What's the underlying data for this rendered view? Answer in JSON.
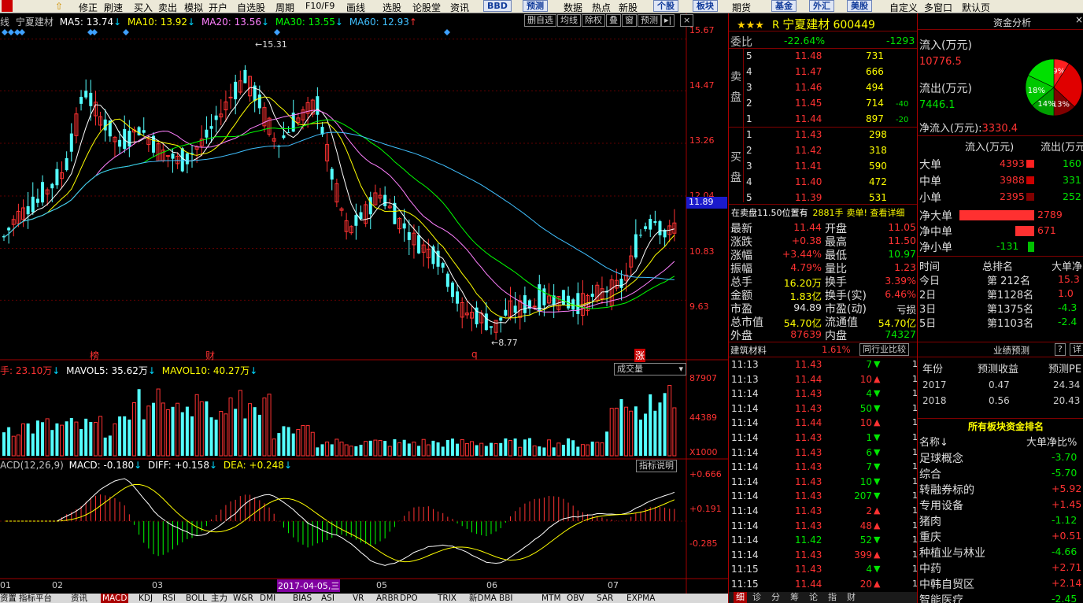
{
  "toolbar": {
    "items": [
      "修正",
      "刷速",
      "买入",
      "卖出",
      "模拟",
      "开户",
      "自选股",
      "周期",
      "F10/F9",
      "画线",
      "选股",
      "论股堂",
      "资讯"
    ],
    "bbd": "BBD",
    "yuce": "预测",
    "items2": [
      "数据",
      "热点",
      "新股"
    ],
    "gegu": "个股",
    "bankuai": "板块",
    "items3": [
      "期货",
      "基金",
      "外汇",
      "美股",
      "自定义",
      "多窗口",
      "默认页"
    ]
  },
  "chart": {
    "ma_line": {
      "prefix": "线",
      "name": "宁夏建材",
      "ma5": "MA5: 13.74",
      "ma10": "MA10: 13.92",
      "ma20": "MA20: 13.56",
      "ma30": "MA30: 13.55",
      "ma60": "MA60: 12.93"
    },
    "top_buttons": [
      "删自选",
      "均线",
      "除权",
      "叠",
      "窗",
      "预测"
    ],
    "price_axis": [
      "15.67",
      "14.47",
      "13.26",
      "12.04",
      "10.83",
      "9.63"
    ],
    "current_price_tag": "11.89",
    "high_label": "15.31",
    "low_label": "8.77",
    "markers": [
      "榜",
      "财",
      "q",
      "涨"
    ],
    "volume": {
      "label": "手: 23.10万",
      "mavol5": "MAVOL5: 35.62万",
      "mavol10": "MAVOL10: 40.27万",
      "button": "成交量",
      "axis": [
        "87907",
        "44389"
      ],
      "unit": "X1000"
    },
    "macd": {
      "label": "ACD(12,26,9)",
      "macd": "MACD: -0.180",
      "diff": "DIFF: +0.158",
      "dea": "DEA: +0.248",
      "button": "指标说明",
      "axis": [
        "+0.666",
        "+0.191",
        "-0.285"
      ]
    },
    "date_axis": [
      "01",
      "02",
      "03",
      "2017-04-05,三",
      "05",
      "06",
      "07"
    ],
    "bottom_tabs": [
      "资置",
      "指标平台",
      "资讯",
      "MACD",
      "KDJ",
      "RSI",
      "BOLL",
      "主力",
      "W&R",
      "DMI",
      "BIAS",
      "ASI",
      "VR",
      "ARBR",
      "DPO",
      "TRIX",
      "新DMA",
      "BBI",
      "MTM",
      "OBV",
      "SAR",
      "EXPMA"
    ]
  },
  "chart_data": {
    "type": "candlestick",
    "title": "宁夏建材",
    "ylim": [
      8.4,
      15.9
    ],
    "x": [
      "01",
      "02",
      "03",
      "04",
      "05",
      "06",
      "07"
    ],
    "high": 15.31,
    "low": 8.77,
    "last": 11.44
  },
  "quote": {
    "stars": "★★★",
    "flag": "R",
    "name": "宁夏建材",
    "code": "600449",
    "weibi_label": "委比",
    "weibi_value": "-22.64%",
    "weicha": "-1293",
    "sell_label": "卖\n盘",
    "buy_label": "买\n盘",
    "sells": [
      {
        "lvl": "5",
        "price": "11.48",
        "vol": "731",
        "chg": ""
      },
      {
        "lvl": "4",
        "price": "11.47",
        "vol": "666",
        "chg": ""
      },
      {
        "lvl": "3",
        "price": "11.46",
        "vol": "494",
        "chg": ""
      },
      {
        "lvl": "2",
        "price": "11.45",
        "vol": "714",
        "chg": "-40"
      },
      {
        "lvl": "1",
        "price": "11.44",
        "vol": "897",
        "chg": "-20"
      }
    ],
    "buys": [
      {
        "lvl": "1",
        "price": "11.43",
        "vol": "298"
      },
      {
        "lvl": "2",
        "price": "11.42",
        "vol": "318"
      },
      {
        "lvl": "3",
        "price": "11.41",
        "vol": "590"
      },
      {
        "lvl": "4",
        "price": "11.40",
        "vol": "472"
      },
      {
        "lvl": "5",
        "price": "11.39",
        "vol": "531"
      }
    ],
    "notice_pre": "在卖盘11.50位置有",
    "notice_vol": "2881手",
    "notice_post": "卖单! 查看详细",
    "stats": [
      [
        "最新",
        "11.44",
        "开盘",
        "11.05"
      ],
      [
        "涨跌",
        "+0.38",
        "最高",
        "11.50"
      ],
      [
        "涨幅",
        "+3.44%",
        "最低",
        "10.97"
      ],
      [
        "振幅",
        "4.79%",
        "量比",
        "1.23"
      ],
      [
        "总手",
        "16.20万",
        "换手",
        "3.39%"
      ],
      [
        "金额",
        "1.83亿",
        "换手(实)",
        "6.46%"
      ],
      [
        "市盈",
        "94.89",
        "市盈(动)",
        "亏损"
      ],
      [
        "总市值",
        "54.70亿",
        "流通值",
        "54.70亿"
      ],
      [
        "外盘",
        "87639",
        "内盘",
        "74327"
      ]
    ],
    "sector": "建筑材料",
    "sector_pct": "1.61%",
    "sector_btn": "同行业比较",
    "ticks": [
      {
        "t": "11:13",
        "p": "11.43",
        "v": "7",
        "d": "down",
        "c": "green"
      },
      {
        "t": "11:13",
        "p": "11.44",
        "v": "10",
        "d": "up",
        "c": "red"
      },
      {
        "t": "11:14",
        "p": "11.43",
        "v": "4",
        "d": "down",
        "c": "green"
      },
      {
        "t": "11:14",
        "p": "11.43",
        "v": "50",
        "d": "down",
        "c": "green"
      },
      {
        "t": "11:14",
        "p": "11.44",
        "v": "10",
        "d": "up",
        "c": "red"
      },
      {
        "t": "11:14",
        "p": "11.43",
        "v": "1",
        "d": "down",
        "c": "green"
      },
      {
        "t": "11:14",
        "p": "11.43",
        "v": "6",
        "d": "down",
        "c": "green"
      },
      {
        "t": "11:14",
        "p": "11.43",
        "v": "7",
        "d": "down",
        "c": "green"
      },
      {
        "t": "11:14",
        "p": "11.43",
        "v": "10",
        "d": "down",
        "c": "green"
      },
      {
        "t": "11:14",
        "p": "11.43",
        "v": "207",
        "d": "down",
        "c": "green"
      },
      {
        "t": "11:14",
        "p": "11.43",
        "v": "2",
        "d": "up",
        "c": "red"
      },
      {
        "t": "11:14",
        "p": "11.43",
        "v": "48",
        "d": "up",
        "c": "red"
      },
      {
        "t": "11:14",
        "p": "11.42",
        "v": "52",
        "d": "down",
        "c": "green"
      },
      {
        "t": "11:14",
        "p": "11.43",
        "v": "399",
        "d": "up",
        "c": "red"
      },
      {
        "t": "11:15",
        "p": "11.43",
        "v": "4",
        "d": "down",
        "c": "green"
      },
      {
        "t": "11:15",
        "p": "11.44",
        "v": "20",
        "d": "up",
        "c": "red"
      }
    ],
    "tick_tabs": [
      "细",
      "诊",
      "分",
      "筹",
      "论",
      "指",
      "财"
    ]
  },
  "funds": {
    "title": "资金分析",
    "inflow_label": "流入(万元)",
    "inflow": "10776.5",
    "outflow_label": "流出(万元)",
    "outflow": "7446.1",
    "net_label": "净流入(万元):",
    "net": "3330.4",
    "pie": [
      {
        "label": "9%",
        "value": 9,
        "color": "#ff2020"
      },
      {
        "label": "",
        "value": 28,
        "color": "#e00000"
      },
      {
        "label": "13%",
        "value": 13,
        "color": "#800000"
      },
      {
        "label": "14%",
        "value": 14,
        "color": "#00a000"
      },
      {
        "label": "18%",
        "value": 18,
        "color": "#00c800"
      },
      {
        "label": "",
        "value": 18,
        "color": "#00e000"
      }
    ],
    "table_head": [
      "流入(万元)",
      "流出(万元)"
    ],
    "table": [
      {
        "name": "大单",
        "in": "4393",
        "out": "160"
      },
      {
        "name": "中单",
        "in": "3988",
        "out": "331"
      },
      {
        "name": "小单",
        "in": "2395",
        "out": "252"
      }
    ],
    "net_rows": [
      {
        "name": "净大单",
        "value": "2789",
        "pct": 0.35
      },
      {
        "name": "净中单",
        "value": "671",
        "pct": 0.09
      },
      {
        "name": "净小单",
        "value": "-131",
        "pct": 0.03
      }
    ],
    "rank_head": [
      "时间",
      "总排名",
      "大单净"
    ],
    "ranks": [
      {
        "t": "今日",
        "r": "第 212名",
        "v": "15.3"
      },
      {
        "t": "2日",
        "r": "第1128名",
        "v": "1.0"
      },
      {
        "t": "3日",
        "r": "第1375名",
        "v": "-4.3"
      },
      {
        "t": "5日",
        "r": "第1103名",
        "v": "-2.4"
      }
    ],
    "forecast_title": "业绩预测",
    "forecast_q": "?",
    "forecast_x": "详",
    "forecast_head": [
      "年份",
      "预测收益",
      "预测PE"
    ],
    "forecast": [
      {
        "y": "2017",
        "e": "0.47",
        "pe": "24.34"
      },
      {
        "y": "2018",
        "e": "0.56",
        "pe": "20.43"
      }
    ],
    "sector_title": "所有板块资金排名",
    "sector_head": [
      "名称",
      "大单净比%"
    ],
    "sectors": [
      {
        "n": "足球概念",
        "v": "-3.70",
        "c": "green"
      },
      {
        "n": "综合",
        "v": "-5.70",
        "c": "green"
      },
      {
        "n": "转融券标的",
        "v": "+5.92",
        "c": "red"
      },
      {
        "n": "专用设备",
        "v": "+1.45",
        "c": "red"
      },
      {
        "n": "猪肉",
        "v": "-1.12",
        "c": "green"
      },
      {
        "n": "重庆",
        "v": "+0.51",
        "c": "red"
      },
      {
        "n": "种植业与林业",
        "v": "-4.66",
        "c": "green"
      },
      {
        "n": "中药",
        "v": "+2.71",
        "c": "red"
      },
      {
        "n": "中韩自贸区",
        "v": "+2.14",
        "c": "red"
      },
      {
        "n": "智能医疗",
        "v": "-2.45",
        "c": "green"
      }
    ]
  }
}
